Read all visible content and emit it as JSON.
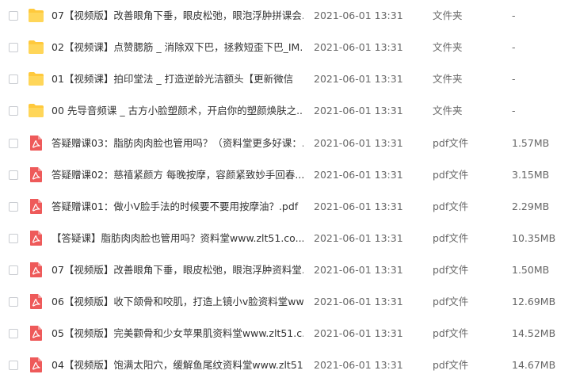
{
  "icons": {
    "folder": "folder-icon",
    "pdf": "pdf-file-icon"
  },
  "colors": {
    "folder": "#ffc93c",
    "pdf": "#ee5a5a"
  },
  "files": [
    {
      "icon": "folder",
      "name": "07【视频版】改善眼角下垂，眼皮松弛，眼泡浮肿拼课会...",
      "modified": "2021-06-01 13:31",
      "type": "文件夹",
      "size": "-"
    },
    {
      "icon": "folder",
      "name": "02【视频课】点赞腮筋 _ 消除双下巴，拯救短歪下巴_IM...",
      "modified": "2021-06-01 13:31",
      "type": "文件夹",
      "size": "-"
    },
    {
      "icon": "folder",
      "name": "01【视频课】拍印堂法 _ 打造逆龄光洁额头【更新微信",
      "modified": "2021-06-01 13:31",
      "type": "文件夹",
      "size": "-"
    },
    {
      "icon": "folder",
      "name": "00 先导音频课 _ 古方小脸塑颜术，开启你的塑颜焕肤之...",
      "modified": "2021-06-01 13:31",
      "type": "文件夹",
      "size": "-"
    },
    {
      "icon": "pdf",
      "name": "答疑赠课03：脂肪肉肉脸也管用吗？（资料堂更多好课：...",
      "modified": "2021-06-01 13:31",
      "type": "pdf文件",
      "size": "1.57MB"
    },
    {
      "icon": "pdf",
      "name": "答疑赠课02：慈禧紧颜方 每晚按摩，容颜紧致妙手回春...",
      "modified": "2021-06-01 13:31",
      "type": "pdf文件",
      "size": "3.15MB"
    },
    {
      "icon": "pdf",
      "name": "答疑赠课01：做小V脸手法的时候要不要用按摩油？.pdf",
      "modified": "2021-06-01 13:31",
      "type": "pdf文件",
      "size": "2.29MB"
    },
    {
      "icon": "pdf",
      "name": "【答疑课】脂肪肉肉脸也管用吗？资料堂www.zlt51.co...",
      "modified": "2021-06-01 13:31",
      "type": "pdf文件",
      "size": "10.35MB"
    },
    {
      "icon": "pdf",
      "name": "07【视频版】改善眼角下垂，眼皮松弛，眼泡浮肿资料堂...",
      "modified": "2021-06-01 13:31",
      "type": "pdf文件",
      "size": "1.50MB"
    },
    {
      "icon": "pdf",
      "name": "06【视频版】收下颌骨和咬肌，打造上镜小v脸资料堂ww...",
      "modified": "2021-06-01 13:31",
      "type": "pdf文件",
      "size": "12.69MB"
    },
    {
      "icon": "pdf",
      "name": "05【视频版】完美颧骨和少女苹果肌资料堂www.zlt51.c...",
      "modified": "2021-06-01 13:31",
      "type": "pdf文件",
      "size": "14.52MB"
    },
    {
      "icon": "pdf",
      "name": "04【视频版】饱满太阳穴，缓解鱼尾纹资料堂www.zlt51...",
      "modified": "2021-06-01 13:31",
      "type": "pdf文件",
      "size": "14.67MB"
    }
  ]
}
